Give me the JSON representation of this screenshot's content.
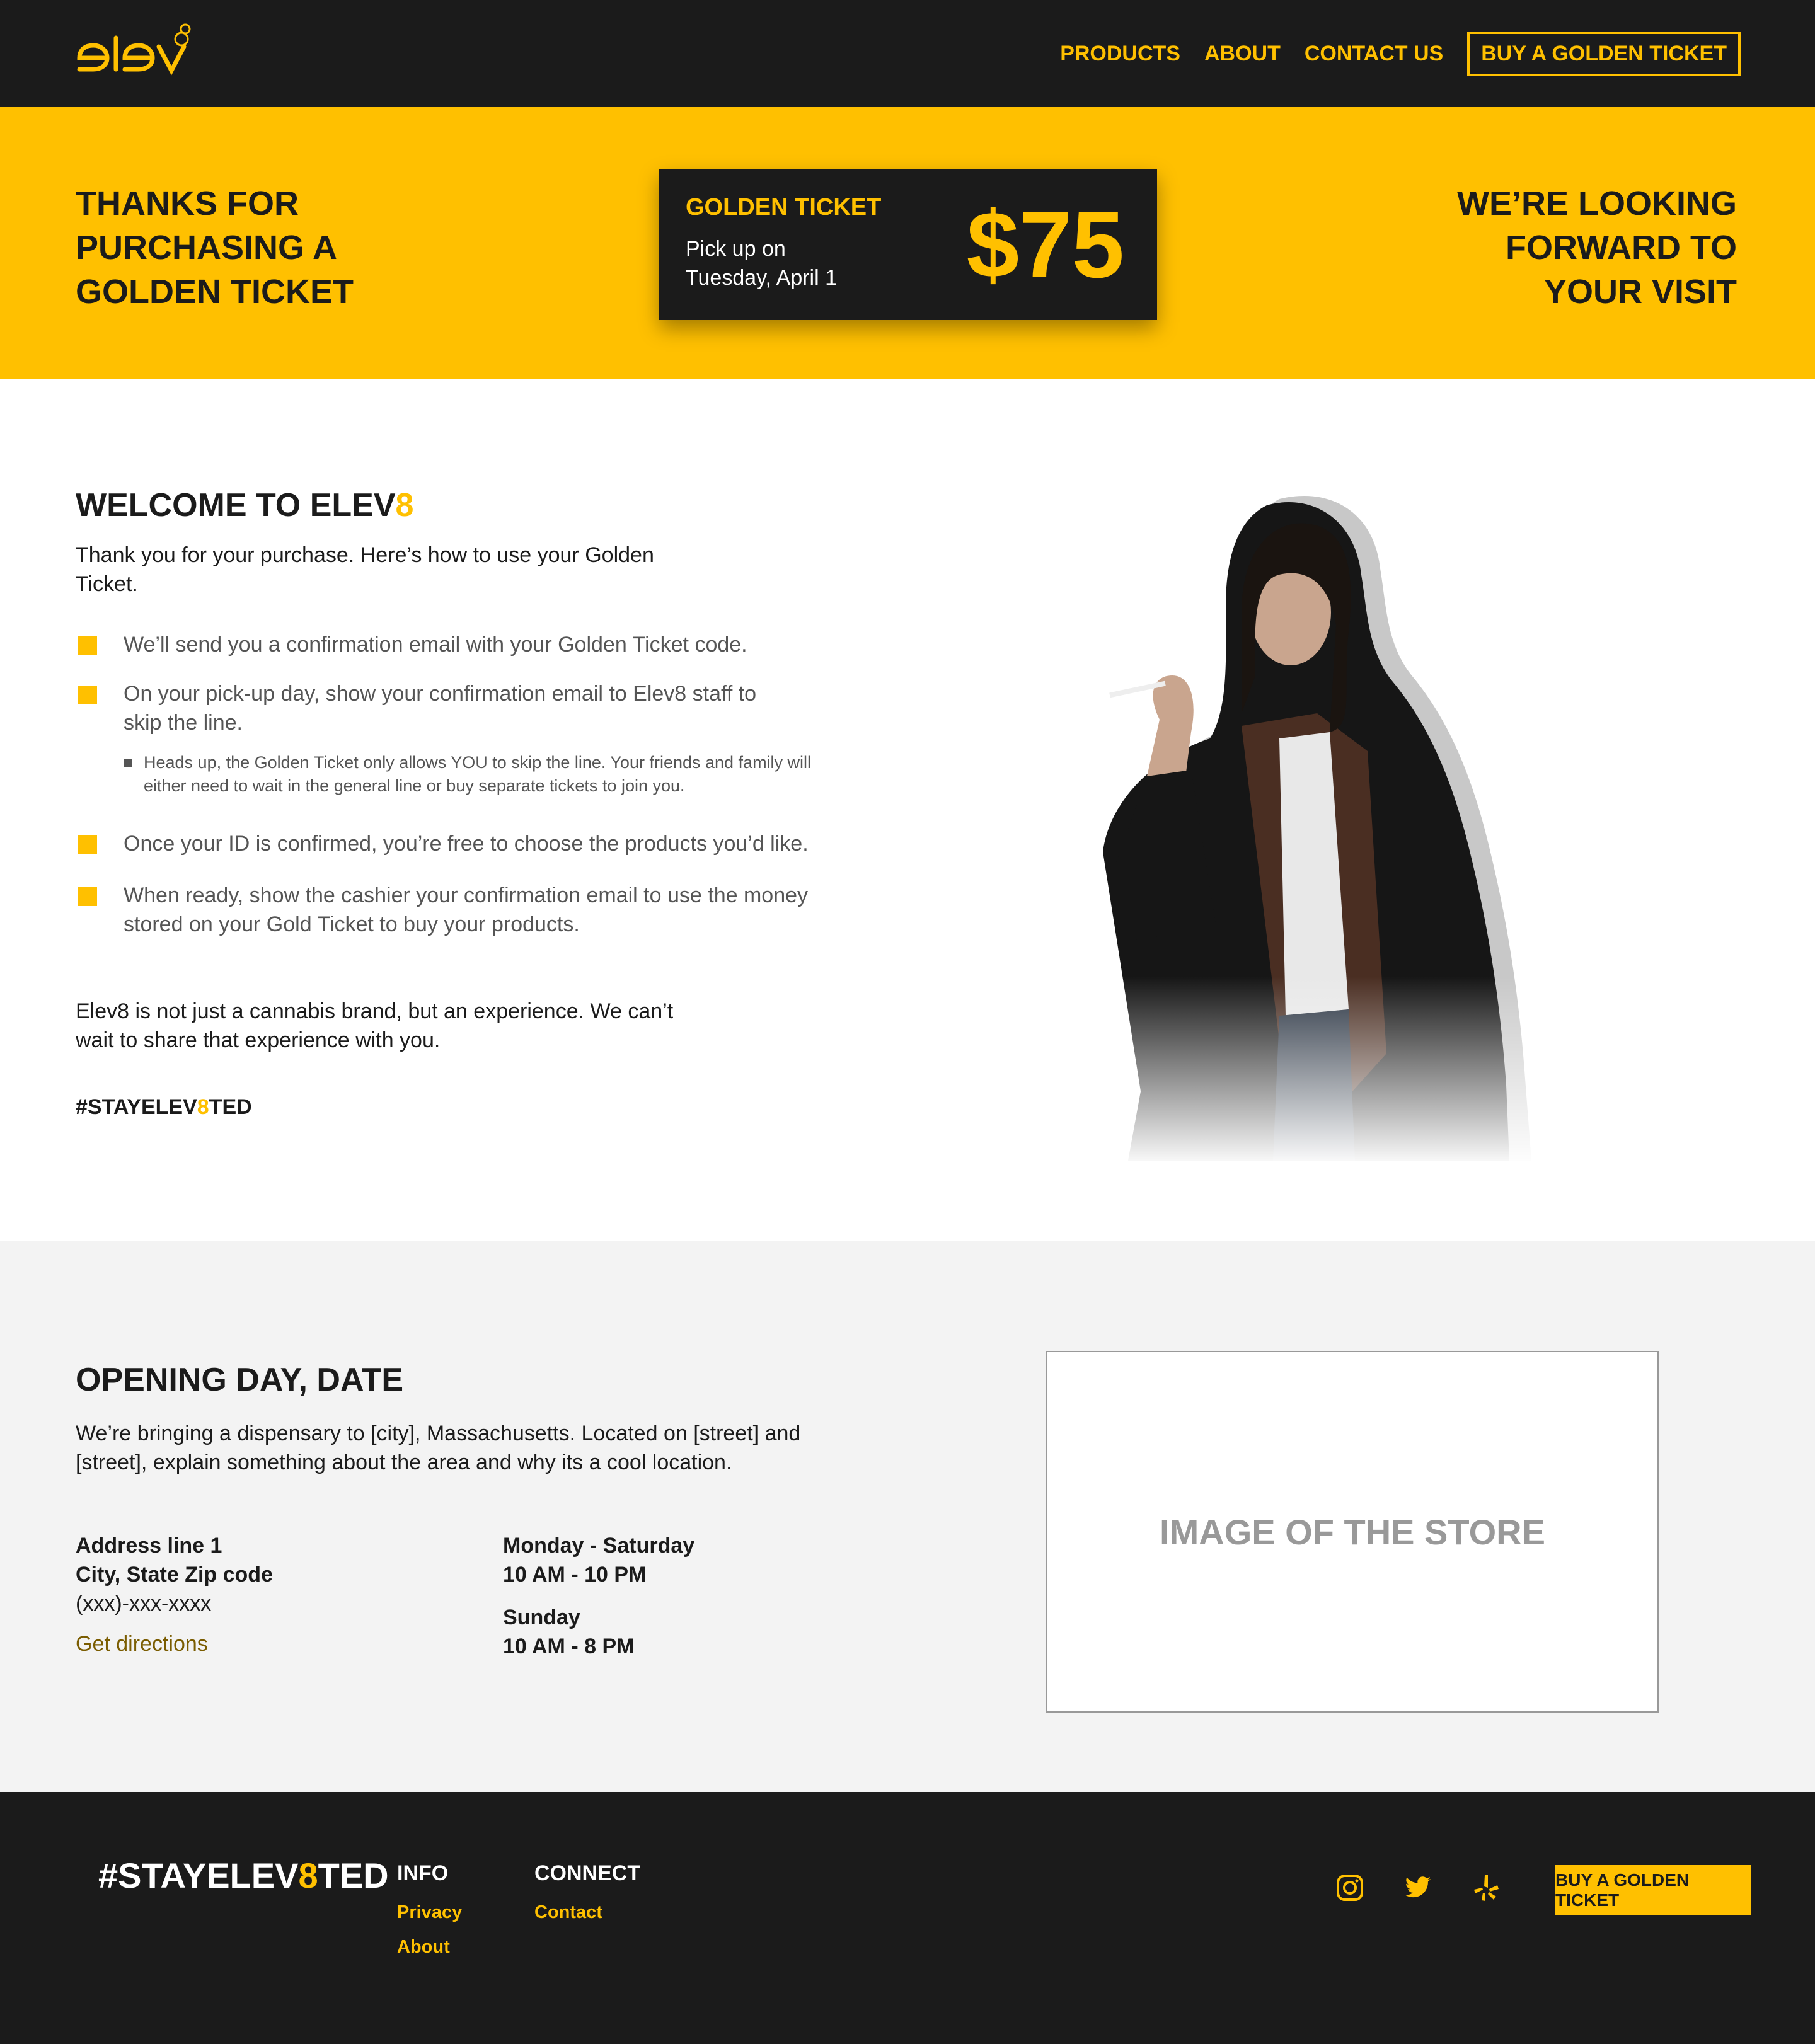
{
  "brand": {
    "name": "elev",
    "accent": "#ffc000",
    "dark": "#1b1b1b"
  },
  "nav": {
    "items": [
      "PRODUCTS",
      "ABOUT",
      "CONTACT US"
    ],
    "cta": "BUY A GOLDEN TICKET"
  },
  "banner": {
    "left_line1": "THANKS FOR PURCHASING A",
    "left_line2": "GOLDEN TICKET",
    "right_line1": "WE’RE LOOKING FORWARD TO",
    "right_line2": "YOUR VISIT",
    "ticket": {
      "title": "GOLDEN TICKET",
      "pickup_line1": "Pick up on",
      "pickup_line2": "Tuesday, April 1",
      "price": "$75"
    }
  },
  "welcome": {
    "title_main": "WELCOME TO ELEV",
    "title_accent": "8",
    "intro": "Thank you for your purchase. Here’s how to use your Golden Ticket.",
    "steps": [
      "We’ll send you a confirmation email with your Golden Ticket code.",
      "On your pick-up day, show your confirmation email to Elev8 staff to skip the line.",
      "Once your ID is confirmed, you’re free to choose the products you’d like.",
      "When ready, show the cashier your confirmation email to use the money stored on your Gold Ticket to buy your products."
    ],
    "sub_note": "Heads up, the Golden Ticket only allows YOU to skip the line. Your friends and family will either need to wait in the general line or buy separate tickets to join you.",
    "outro": "Elev8 is not just a cannabis brand, but an experience. We can’t wait to share that experience with you.",
    "hashtag_pre": "#STAYELEV",
    "hashtag_accent": "8",
    "hashtag_post": "TED"
  },
  "opening": {
    "title": "OPENING DAY, DATE",
    "text": "We’re bringing a dispensary to [city], Massachusetts. Located on [street] and [street], explain something about the area and why its a cool location.",
    "address": [
      "Address line 1",
      "City, State Zip code",
      "(xxx)-xxx-xxxx"
    ],
    "directions": "Get directions",
    "hours": [
      {
        "days": "Monday - Saturday",
        "time": "10 AM - 10 PM"
      },
      {
        "days": "Sunday",
        "time": "10 AM - 8 PM"
      }
    ],
    "store_placeholder": "IMAGE OF THE STORE"
  },
  "footer": {
    "hashtag_pre": "#STAYELEV",
    "hashtag_accent": "8",
    "hashtag_post": "TED",
    "info_title": "INFO",
    "info_links": [
      "Privacy",
      "About"
    ],
    "connect_title": "CONNECT",
    "connect_links": [
      "Contact"
    ],
    "social_icons": [
      "instagram-icon",
      "twitter-icon",
      "yelp-icon"
    ],
    "cta": "BUY A GOLDEN TICKET"
  }
}
